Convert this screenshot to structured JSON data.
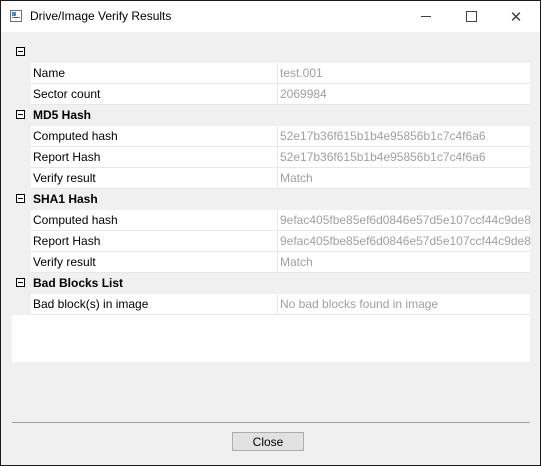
{
  "window": {
    "title": "Drive/Image Verify Results"
  },
  "grid": {
    "general": {
      "rows": [
        {
          "name": "Name",
          "value": "test.001"
        },
        {
          "name": "Sector count",
          "value": "2069984"
        }
      ]
    },
    "md5": {
      "label": "MD5 Hash",
      "rows": [
        {
          "name": "Computed hash",
          "value": "52e17b36f615b1b4e95856b1c7c4f6a6"
        },
        {
          "name": "Report Hash",
          "value": "52e17b36f615b1b4e95856b1c7c4f6a6"
        },
        {
          "name": "Verify result",
          "value": "Match"
        }
      ]
    },
    "sha1": {
      "label": "SHA1 Hash",
      "rows": [
        {
          "name": "Computed hash",
          "value": "9efac405fbe85ef6d0846e57d5e107ccf44c9de8"
        },
        {
          "name": "Report Hash",
          "value": "9efac405fbe85ef6d0846e57d5e107ccf44c9de8"
        },
        {
          "name": "Verify result",
          "value": "Match"
        }
      ]
    },
    "bad_blocks": {
      "label": "Bad Blocks List",
      "rows": [
        {
          "name": "Bad block(s) in image",
          "value": "No bad blocks found in image"
        }
      ]
    }
  },
  "footer": {
    "close_label": "Close"
  },
  "icons": {
    "collapse": "minus-box-icon",
    "app": "app-window-icon",
    "minimize": "minimize-icon",
    "maximize": "maximize-icon",
    "close": "close-icon"
  }
}
